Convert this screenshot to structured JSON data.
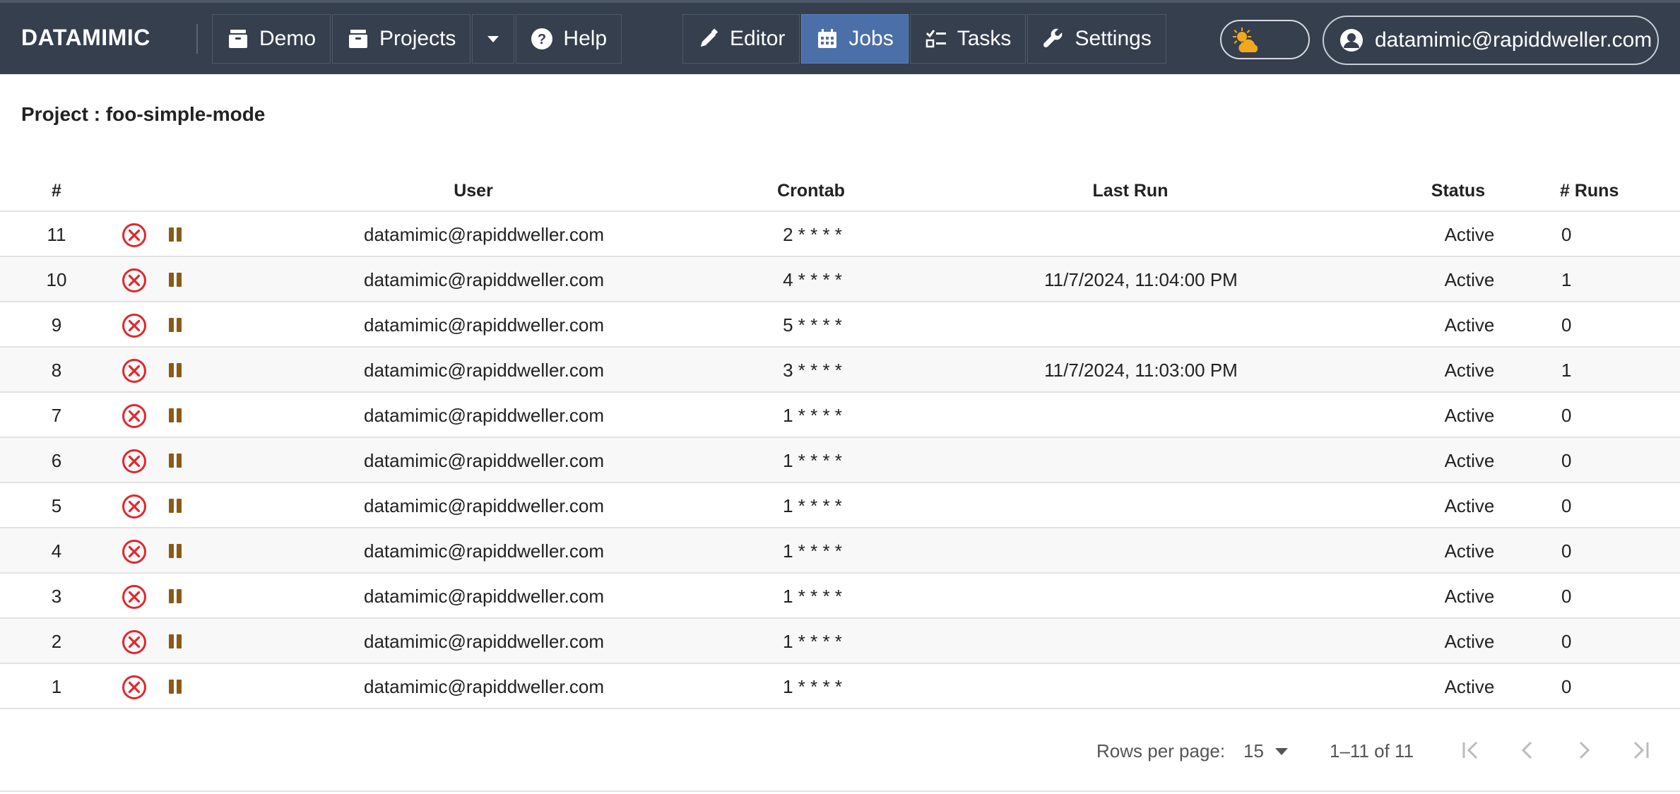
{
  "app": {
    "brand": "DATAMIMIC"
  },
  "nav": {
    "left": [
      {
        "label": "Demo",
        "icon": "archive-icon"
      },
      {
        "label": "Projects",
        "icon": "archive-icon"
      }
    ],
    "help_label": "Help",
    "center": [
      {
        "label": "Editor",
        "icon": "pencil-icon",
        "active": false
      },
      {
        "label": "Jobs",
        "icon": "calendar-icon",
        "active": true
      },
      {
        "label": "Tasks",
        "icon": "checklist-icon",
        "active": false
      },
      {
        "label": "Settings",
        "icon": "wrench-icon",
        "active": false
      }
    ],
    "user_email": "datamimic@rapiddweller.com"
  },
  "project": {
    "title": "Project : foo-simple-mode"
  },
  "table": {
    "headers": {
      "num": "#",
      "user": "User",
      "crontab": "Crontab",
      "last_run": "Last Run",
      "status": "Status",
      "runs": "# Runs"
    },
    "rows": [
      {
        "num": "11",
        "user": "datamimic@rapiddweller.com",
        "crontab": "2 * * * *",
        "last_run": "",
        "status": "Active",
        "runs": "0"
      },
      {
        "num": "10",
        "user": "datamimic@rapiddweller.com",
        "crontab": "4 * * * *",
        "last_run": "11/7/2024, 11:04:00 PM",
        "status": "Active",
        "runs": "1"
      },
      {
        "num": "9",
        "user": "datamimic@rapiddweller.com",
        "crontab": "5 * * * *",
        "last_run": "",
        "status": "Active",
        "runs": "0"
      },
      {
        "num": "8",
        "user": "datamimic@rapiddweller.com",
        "crontab": "3 * * * *",
        "last_run": "11/7/2024, 11:03:00 PM",
        "status": "Active",
        "runs": "1"
      },
      {
        "num": "7",
        "user": "datamimic@rapiddweller.com",
        "crontab": "1 * * * *",
        "last_run": "",
        "status": "Active",
        "runs": "0"
      },
      {
        "num": "6",
        "user": "datamimic@rapiddweller.com",
        "crontab": "1 * * * *",
        "last_run": "",
        "status": "Active",
        "runs": "0"
      },
      {
        "num": "5",
        "user": "datamimic@rapiddweller.com",
        "crontab": "1 * * * *",
        "last_run": "",
        "status": "Active",
        "runs": "0"
      },
      {
        "num": "4",
        "user": "datamimic@rapiddweller.com",
        "crontab": "1 * * * *",
        "last_run": "",
        "status": "Active",
        "runs": "0"
      },
      {
        "num": "3",
        "user": "datamimic@rapiddweller.com",
        "crontab": "1 * * * *",
        "last_run": "",
        "status": "Active",
        "runs": "0"
      },
      {
        "num": "2",
        "user": "datamimic@rapiddweller.com",
        "crontab": "1 * * * *",
        "last_run": "",
        "status": "Active",
        "runs": "0"
      },
      {
        "num": "1",
        "user": "datamimic@rapiddweller.com",
        "crontab": "1 * * * *",
        "last_run": "",
        "status": "Active",
        "runs": "0"
      }
    ]
  },
  "pagination": {
    "rows_per_page_label": "Rows per page:",
    "rows_per_page": "15",
    "range": "1–11 of 11"
  },
  "colors": {
    "header_bg": "#353f4e",
    "active_tab": "#4b6fa8",
    "delete_icon": "#e0282e",
    "pause_icon": "#8a5a17",
    "sun_icon": "#f0a91c"
  }
}
